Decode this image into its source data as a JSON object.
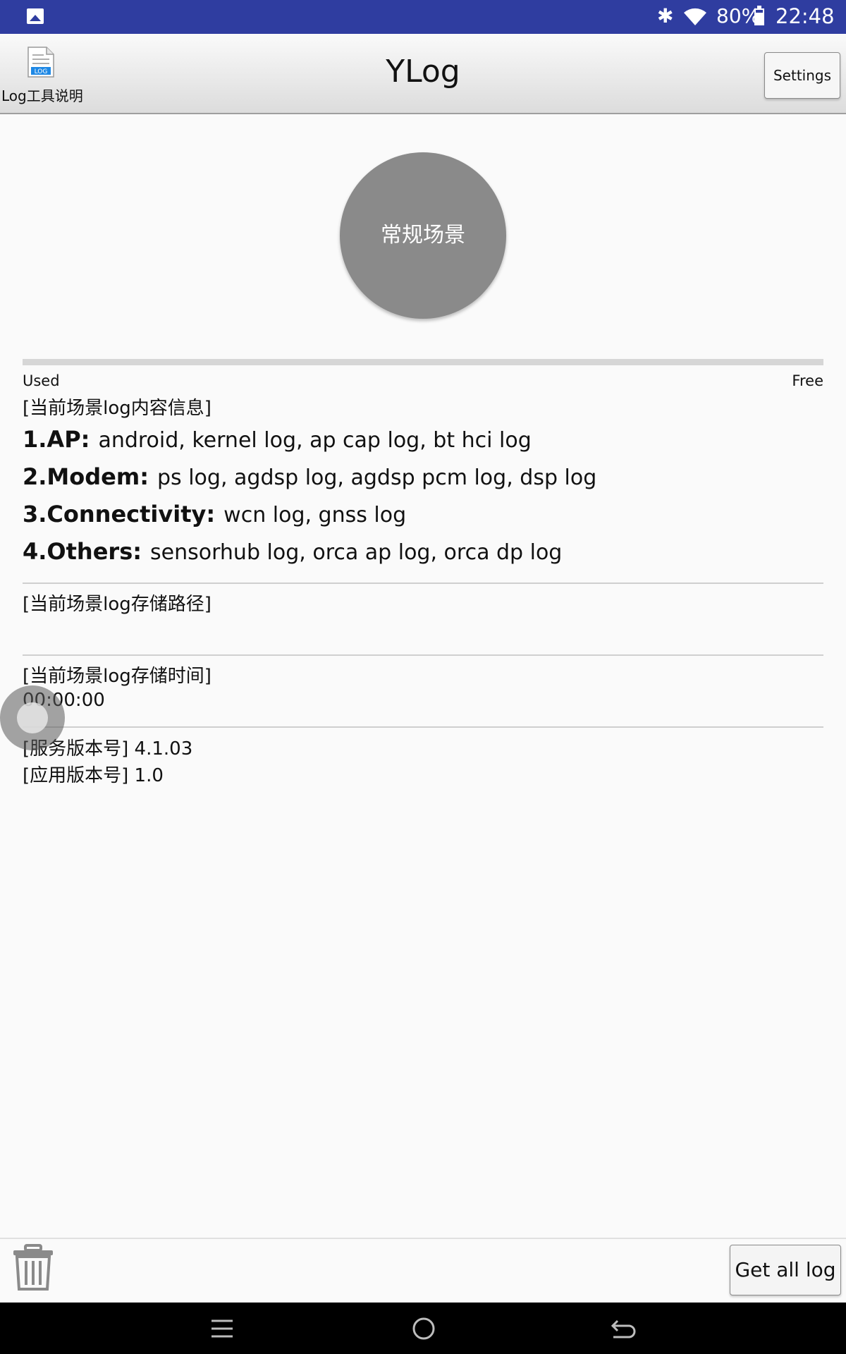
{
  "status_bar": {
    "battery_percent": "80%",
    "battery_level": 0.8,
    "time": "22:48",
    "icons": [
      "image-icon",
      "bluetooth-icon",
      "wifi-icon",
      "battery-icon"
    ]
  },
  "app_bar": {
    "title": "YLog",
    "help_label": "Log工具说明",
    "help_icon_text": "LOG",
    "settings_label": "Settings"
  },
  "scenario": {
    "label": "常规场景"
  },
  "storage": {
    "used_label": "Used",
    "free_label": "Free",
    "used_fraction": 0.0
  },
  "content_info": {
    "title": "[当前场景log内容信息]",
    "lines": [
      {
        "key": "1.AP:",
        "value": "android, kernel log, ap cap log, bt hci log"
      },
      {
        "key": "2.Modem:",
        "value": "ps log, agdsp log, agdsp pcm log, dsp log"
      },
      {
        "key": "3.Connectivity:",
        "value": "wcn log, gnss log"
      },
      {
        "key": "4.Others:",
        "value": "sensorhub log, orca ap log, orca dp log"
      }
    ]
  },
  "storage_path": {
    "title": "[当前场景log存储路径]",
    "value": ""
  },
  "storage_time": {
    "title": "[当前场景log存储时间]",
    "value": "00:00:00"
  },
  "versions": {
    "service": "[服务版本号] 4.1.03",
    "app": "[应用版本号] 1.0"
  },
  "bottom_bar": {
    "get_all_log_label": "Get all log"
  }
}
